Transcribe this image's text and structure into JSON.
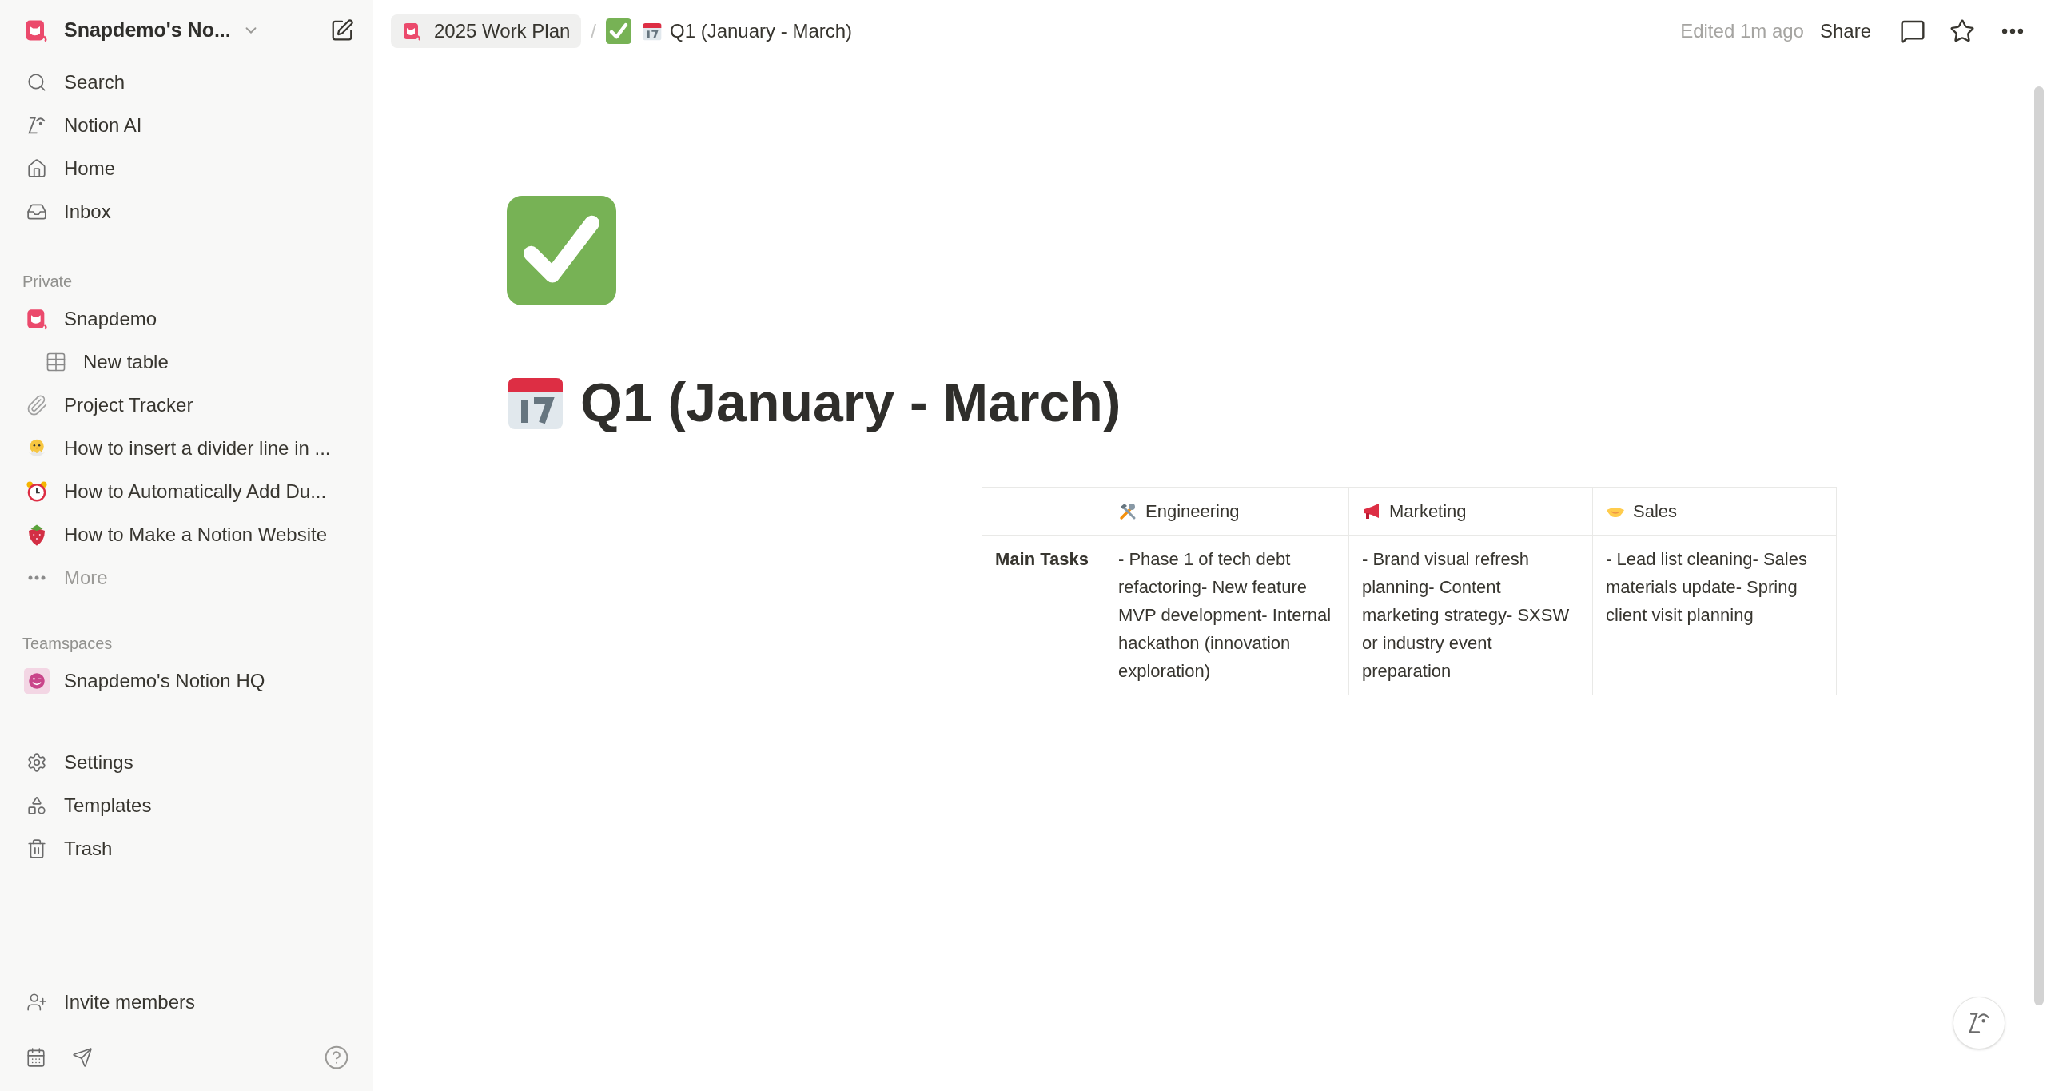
{
  "sidebar": {
    "workspace": "Snapdemo's No...",
    "nav": [
      {
        "label": "Search"
      },
      {
        "label": "Notion AI"
      },
      {
        "label": "Home"
      },
      {
        "label": "Inbox"
      }
    ],
    "private_label": "Private",
    "private": [
      {
        "label": "Snapdemo",
        "children": [
          {
            "label": "New table"
          }
        ]
      },
      {
        "label": "Project Tracker"
      },
      {
        "label": "How to insert a divider line in ..."
      },
      {
        "label": "How to Automatically Add Du..."
      },
      {
        "label": "How to Make a Notion Website"
      }
    ],
    "more": "More",
    "teamspaces_label": "Teamspaces",
    "teamspaces": [
      {
        "label": "Snapdemo's Notion HQ"
      }
    ],
    "tools": [
      {
        "label": "Settings"
      },
      {
        "label": "Templates"
      },
      {
        "label": "Trash"
      }
    ],
    "invite": "Invite members"
  },
  "topbar": {
    "breadcrumbs": [
      {
        "label": "2025 Work Plan"
      },
      {
        "label": "Q1 (January - March)"
      }
    ],
    "separator": "/",
    "edited": "Edited 1m ago",
    "share": "Share"
  },
  "page": {
    "title": "Q1 (January - March)",
    "table": {
      "columns": [
        "Engineering",
        "Marketing",
        "Sales"
      ],
      "rows": [
        {
          "header": "Main Tasks",
          "cells": [
            "- Phase 1 of tech debt refactoring- New feature MVP development- Internal hackathon (innovation exploration)",
            "- Brand visual refresh planning- Content marketing strategy- SXSW or industry event preparation",
            "- Lead list cleaning- Sales materials update- Spring client visit planning"
          ]
        }
      ]
    }
  }
}
